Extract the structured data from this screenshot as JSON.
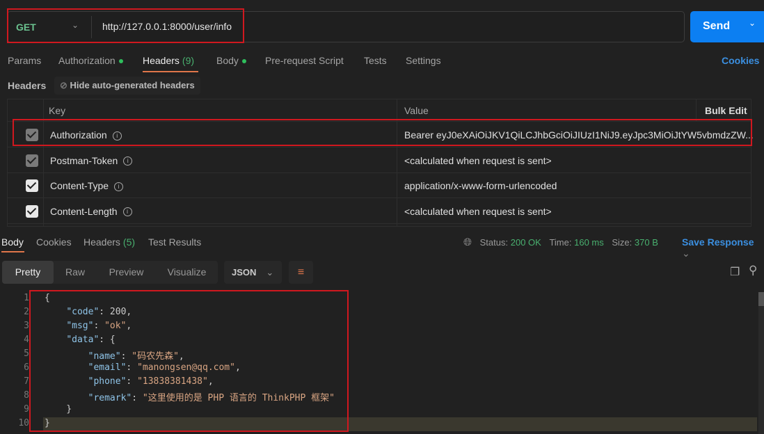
{
  "request": {
    "method": "GET",
    "url": "http://127.0.0.1:8000/user/info",
    "send_label": "Send"
  },
  "tabs": [
    {
      "label": "Params"
    },
    {
      "label": "Authorization",
      "dot": true
    },
    {
      "label": "Headers",
      "count": "(9)",
      "active": true
    },
    {
      "label": "Body",
      "dot": true
    },
    {
      "label": "Pre-request Script"
    },
    {
      "label": "Tests"
    },
    {
      "label": "Settings"
    }
  ],
  "cookies_link": "Cookies",
  "headers_section": {
    "label": "Headers",
    "hide_button": "Hide auto-generated headers"
  },
  "table": {
    "columns": [
      "Key",
      "Value"
    ],
    "bulk_edit": "Bulk Edit",
    "rows": [
      {
        "key": "Authorization",
        "value": "Bearer eyJ0eXAiOiJKV1QiLCJhbGciOiJIUzI1NiJ9.eyJpc3MiOiJtYW5vbmdzZW...",
        "checked": true,
        "auto": true
      },
      {
        "key": "Postman-Token",
        "value": "<calculated when request is sent>",
        "checked": true,
        "auto": true
      },
      {
        "key": "Content-Type",
        "value": "application/x-www-form-urlencoded",
        "checked": true,
        "auto": false
      },
      {
        "key": "Content-Length",
        "value": "<calculated when request is sent>",
        "checked": true,
        "auto": false
      }
    ]
  },
  "response": {
    "tabs": [
      {
        "label": "Body",
        "active": true
      },
      {
        "label": "Cookies"
      },
      {
        "label": "Headers",
        "count": "(5)"
      },
      {
        "label": "Test Results"
      }
    ],
    "status_label": "Status:",
    "status": "200 OK",
    "time_label": "Time:",
    "time": "160 ms",
    "size_label": "Size:",
    "size": "370 B",
    "save": "Save Response",
    "views": [
      "Pretty",
      "Raw",
      "Preview",
      "Visualize"
    ],
    "format": "JSON",
    "lines": [
      [
        [
          "p",
          "{"
        ]
      ],
      [
        [
          "p",
          "    "
        ],
        [
          "k",
          "\"code\""
        ],
        [
          "p",
          ": 200,"
        ]
      ],
      [
        [
          "p",
          "    "
        ],
        [
          "k",
          "\"msg\""
        ],
        [
          "p",
          ": "
        ],
        [
          "s",
          "\"ok\""
        ],
        [
          "p",
          ","
        ]
      ],
      [
        [
          "p",
          "    "
        ],
        [
          "k",
          "\"data\""
        ],
        [
          "p",
          ": {"
        ]
      ],
      [
        [
          "p",
          "        "
        ],
        [
          "k",
          "\"name\""
        ],
        [
          "p",
          ": "
        ],
        [
          "s",
          "\"码农先森\""
        ],
        [
          "p",
          ","
        ]
      ],
      [
        [
          "p",
          "        "
        ],
        [
          "k",
          "\"email\""
        ],
        [
          "p",
          ": "
        ],
        [
          "s",
          "\"manongsen@qq.com\""
        ],
        [
          "p",
          ","
        ]
      ],
      [
        [
          "p",
          "        "
        ],
        [
          "k",
          "\"phone\""
        ],
        [
          "p",
          ": "
        ],
        [
          "s",
          "\"13838381438\""
        ],
        [
          "p",
          ","
        ]
      ],
      [
        [
          "p",
          "        "
        ],
        [
          "k",
          "\"remark\""
        ],
        [
          "p",
          ": "
        ],
        [
          "s",
          "\"这里使用的是 PHP 语言的 ThinkPHP 框架\""
        ]
      ],
      [
        [
          "p",
          "    }"
        ]
      ],
      [
        [
          "p",
          "}"
        ]
      ]
    ]
  }
}
